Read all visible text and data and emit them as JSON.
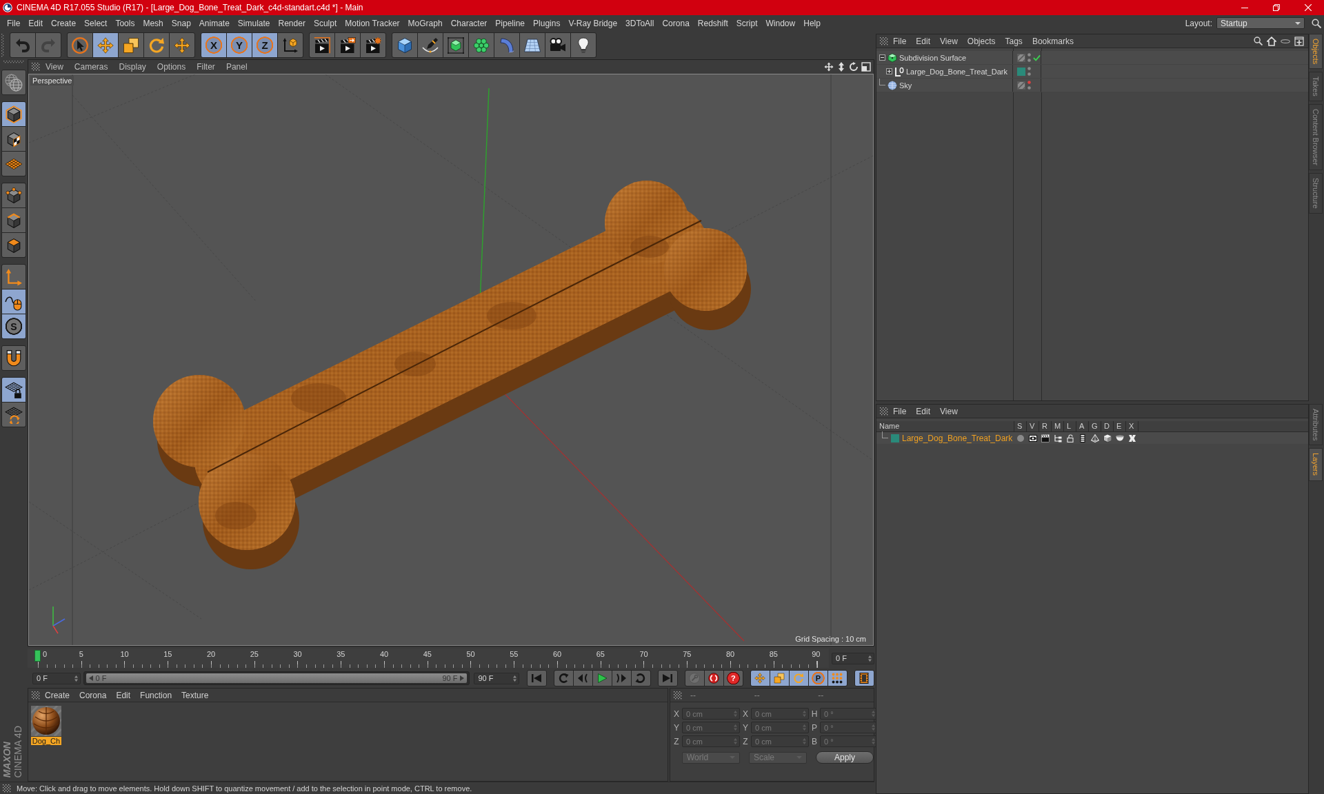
{
  "window": {
    "title": "CINEMA 4D R17.055 Studio (R17) - [Large_Dog_Bone_Treat_Dark_c4d-standart.c4d *] - Main"
  },
  "menu_bar": {
    "items": [
      "File",
      "Edit",
      "Create",
      "Select",
      "Tools",
      "Mesh",
      "Snap",
      "Animate",
      "Simulate",
      "Render",
      "Sculpt",
      "Motion Tracker",
      "MoGraph",
      "Character",
      "Pipeline",
      "Plugins",
      "V-Ray Bridge",
      "3DToAll",
      "Corona",
      "Redshift",
      "Script",
      "Window",
      "Help"
    ],
    "layout_label": "Layout:",
    "layout_value": "Startup"
  },
  "toolbar": {
    "groups": [
      [
        {
          "kind": "icon",
          "selected": false,
          "disabled": false
        },
        {
          "kind": "icon",
          "selected": false,
          "disabled": true
        }
      ],
      [
        {
          "kind": "icon",
          "selected": false
        },
        {
          "kind": "icon",
          "selected": true
        },
        {
          "kind": "icon",
          "selected": false
        },
        {
          "kind": "icon",
          "selected": false
        },
        {
          "kind": "icon",
          "selected": false
        }
      ],
      [
        {
          "kind": "letter",
          "label": "X",
          "selected": true
        },
        {
          "kind": "letter",
          "label": "Y",
          "selected": true
        },
        {
          "kind": "letter",
          "label": "Z",
          "selected": true
        },
        {
          "kind": "icon",
          "selected": false
        }
      ],
      [
        {
          "kind": "icon",
          "selected": false
        },
        {
          "kind": "icon",
          "selected": false
        },
        {
          "kind": "icon",
          "selected": false
        }
      ],
      [
        {
          "kind": "icon",
          "selected": false
        },
        {
          "kind": "icon",
          "selected": false
        },
        {
          "kind": "icon",
          "selected": false
        },
        {
          "kind": "icon",
          "selected": false
        },
        {
          "kind": "icon",
          "selected": false
        },
        {
          "kind": "icon",
          "selected": false
        },
        {
          "kind": "icon",
          "selected": false
        },
        {
          "kind": "icon",
          "selected": false
        }
      ]
    ]
  },
  "left_tools": {
    "groups": [
      [
        {
          "kind": "icon",
          "selected": false
        }
      ],
      [
        {
          "kind": "icon",
          "selected": true
        },
        {
          "kind": "icon",
          "selected": false
        },
        {
          "kind": "icon",
          "selected": false
        }
      ],
      [
        {
          "kind": "icon",
          "selected": false
        },
        {
          "kind": "icon",
          "selected": false
        },
        {
          "kind": "icon",
          "selected": false
        }
      ],
      [
        {
          "kind": "icon",
          "selected": false
        },
        {
          "kind": "icon",
          "selected": true
        },
        {
          "kind": "letter",
          "label": "S",
          "selected": true
        }
      ],
      [
        {
          "kind": "icon",
          "selected": false
        }
      ],
      [
        {
          "kind": "icon",
          "selected": true
        },
        {
          "kind": "icon",
          "selected": false
        }
      ]
    ]
  },
  "logo": {
    "brand": "MAXON",
    "product": "CINEMA 4D"
  },
  "viewport": {
    "menu": [
      "View",
      "Cameras",
      "Display",
      "Options",
      "Filter",
      "Panel"
    ],
    "camera": "Perspective",
    "grid_spacing": "Grid Spacing : 10 cm"
  },
  "timeline": {
    "frames": [
      "0",
      "5",
      "10",
      "15",
      "20",
      "25",
      "30",
      "35",
      "40",
      "45",
      "50",
      "55",
      "60",
      "65",
      "70",
      "75",
      "80",
      "85",
      "90"
    ],
    "playhead": {
      "level": 0
    },
    "current_frame": "0 F"
  },
  "playback": {
    "start_frame": "0 F",
    "range": {
      "start": "0 F",
      "end": "90 F",
      "level": 1
    },
    "end_frame": "90 F",
    "groups": [
      [
        {
          "kind": "icon",
          "selected": false
        }
      ],
      [
        {
          "kind": "icon",
          "selected": false
        },
        {
          "kind": "icon",
          "selected": false
        },
        {
          "kind": "icon",
          "selected": false
        },
        {
          "kind": "icon",
          "selected": false
        },
        {
          "kind": "icon",
          "selected": false
        }
      ],
      [
        {
          "kind": "icon",
          "selected": false
        }
      ],
      [
        {
          "kind": "icon",
          "selected": false,
          "disabled": true
        },
        {
          "kind": "icon",
          "selected": false,
          "disabled": false
        },
        {
          "kind": "letter",
          "label": "?",
          "selected": false,
          "disabled": false
        }
      ],
      [
        {
          "kind": "icon",
          "selected": true
        },
        {
          "kind": "icon",
          "selected": true
        },
        {
          "kind": "icon",
          "selected": true
        },
        {
          "kind": "letter",
          "label": "P",
          "selected": true
        },
        {
          "kind": "icon",
          "selected": true
        }
      ],
      [
        {
          "kind": "icon",
          "selected": true
        }
      ]
    ]
  },
  "materials": {
    "menu": [
      "Create",
      "Corona",
      "Edit",
      "Function",
      "Texture"
    ],
    "items": [
      {
        "name": "Dog_Ch",
        "selected": true
      }
    ]
  },
  "coordinates": {
    "headers": [
      "--",
      "--",
      "--"
    ],
    "disabled": true,
    "rows": [
      {
        "label_1": "X",
        "value_1": "0 cm",
        "label_2": "X",
        "value_2": "0 cm",
        "label_3": "H",
        "value_3": "0 °"
      },
      {
        "label_1": "Y",
        "value_1": "0 cm",
        "label_2": "Y",
        "value_2": "0 cm",
        "label_3": "P",
        "value_3": "0 °"
      },
      {
        "label_1": "Z",
        "value_1": "0 cm",
        "label_2": "Z",
        "value_2": "0 cm",
        "label_3": "B",
        "value_3": "0 °"
      }
    ],
    "dropdown_1": "World",
    "dropdown_2": "Scale",
    "apply": "Apply"
  },
  "status_bar": {
    "text": "Move: Click and drag to move elements. Hold down SHIFT to quantize movement / add to the selection in point mode, CTRL to remove."
  },
  "object_manager": {
    "menu": [
      "File",
      "Edit",
      "View",
      "Objects",
      "Tags",
      "Bookmarks"
    ],
    "objects": [
      {
        "name": "Subdivision Surface",
        "kind": "subdivision",
        "expanded": true,
        "editor_hidden": false,
        "render_hidden": false,
        "enabled": true,
        "children": [
          {
            "name": "Large_Dog_Bone_Treat_Dark",
            "kind": "null",
            "expanded": false,
            "color": "#2a8a7a",
            "editor_hidden": false,
            "render_hidden": false
          }
        ]
      },
      {
        "name": "Sky",
        "kind": "sky",
        "editor_hidden": true,
        "render_hidden": false
      }
    ]
  },
  "layer_manager": {
    "menu": [
      "File",
      "Edit",
      "View"
    ],
    "columns": [
      "Name",
      "S",
      "V",
      "R",
      "M",
      "L",
      "A",
      "G",
      "D",
      "E",
      "X"
    ],
    "layers": [
      {
        "name": "Large_Dog_Bone_Treat_Dark",
        "color": "#2a8a7a",
        "selected": true,
        "solo": false,
        "visible": true,
        "render": true,
        "manager": true,
        "locked": false,
        "animation": true,
        "generators": true,
        "deformers": true,
        "expressions": true,
        "xrefs": true
      }
    ]
  },
  "side_tabs": {
    "upper": [
      {
        "label": "Objects",
        "selected": true
      },
      {
        "label": "Takes",
        "selected": false
      },
      {
        "label": "Content Browser",
        "selected": false
      },
      {
        "label": "Structure",
        "selected": false
      }
    ],
    "lower": [
      {
        "label": "Attributes",
        "selected": false
      },
      {
        "label": "Layers",
        "selected": true
      }
    ]
  }
}
